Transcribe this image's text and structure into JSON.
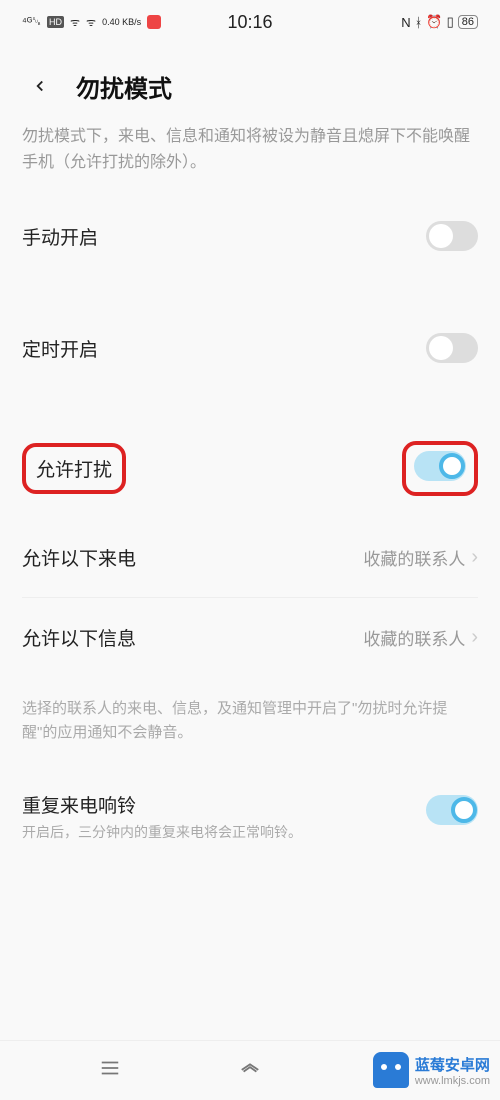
{
  "status": {
    "signal": "4G",
    "hd": "HD",
    "speed": "0.40 KB/s",
    "time": "10:16",
    "nfc": "N",
    "battery": "86"
  },
  "header": {
    "title": "勿扰模式"
  },
  "description": "勿扰模式下，来电、信息和通知将被设为静音且熄屏下不能唤醒手机（允许打扰的除外）。",
  "items": {
    "manual": {
      "label": "手动开启"
    },
    "timed": {
      "label": "定时开启"
    },
    "allow": {
      "label": "允许打扰"
    },
    "allowCalls": {
      "label": "允许以下来电",
      "value": "收藏的联系人"
    },
    "allowMsgs": {
      "label": "允许以下信息",
      "value": "收藏的联系人"
    }
  },
  "note": "选择的联系人的来电、信息，及通知管理中开启了\"勿扰时允许提醒\"的应用通知不会静音。",
  "repeat": {
    "label": "重复来电响铃",
    "sub": "开启后，三分钟内的重复来电将会正常响铃。"
  },
  "watermark": {
    "title": "蓝莓安卓网",
    "url": "www.lmkjs.com"
  }
}
